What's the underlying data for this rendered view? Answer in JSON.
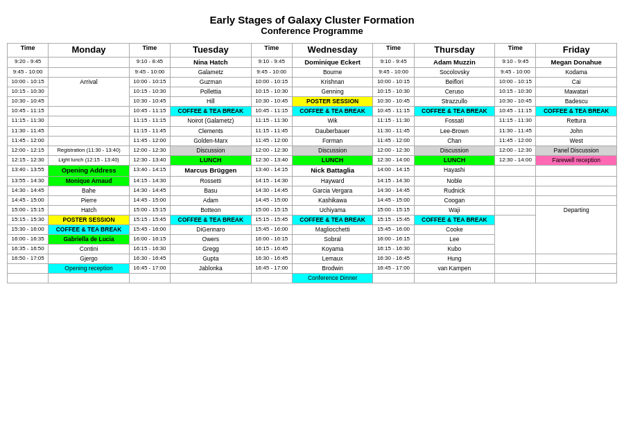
{
  "title": {
    "line1": "Early Stages of Galaxy Cluster Formation",
    "line2": "Conference Programme"
  },
  "headers": {
    "time": "Time",
    "monday": "Monday",
    "tuesday": "Tuesday",
    "wednesday": "Wednesday",
    "thursday": "Thursday",
    "friday": "Friday"
  },
  "tuesday_speaker": "Nina Hatch",
  "wednesday_speaker": "Dominique Eckert",
  "thursday_speaker": "Adam Muzzin",
  "friday_speaker": "Megan Donahue",
  "coffee_break": "COFFEE & TEA BREAK",
  "poster_session": "POSTER SESSION",
  "discussion": "Discussion",
  "lunch": "LUNCH",
  "opening_address": "Opening Address",
  "monique_arnaud": "Monique Arnaud",
  "marcus_bruggen": "Marcus Brüggen",
  "nick_battaglia": "Nick Battaglia",
  "gabriella": "Gabriella de Lucia",
  "opening_reception": "Opening reception",
  "conference_dinner": "Conference Dinner",
  "panel_discussion": "Panel Discussion",
  "farewell_reception": "Farewell reception",
  "departing": "Departing",
  "arrival": "Arrival",
  "registration": "Registration (11:30 - 13:40)",
  "light_lunch": "Light lunch (12:15 - 13:40)"
}
